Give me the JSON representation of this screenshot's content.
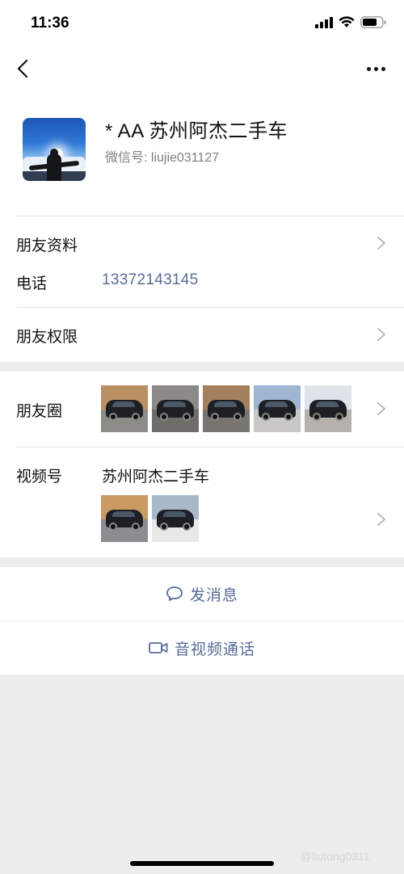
{
  "status_bar": {
    "time": "11:36"
  },
  "profile": {
    "name": "* AA 苏州阿杰二手车",
    "wechat_id": "微信号: liujie031127"
  },
  "rows": {
    "friend_info": "朋友资料",
    "phone_label": "电话",
    "phone_value": "13372143145",
    "permissions": "朋友权限",
    "moments": "朋友圈",
    "channels": "视频号",
    "channels_author": "苏州阿杰二手车"
  },
  "actions": {
    "message": "发消息",
    "call": "音视频通话"
  },
  "icons": {
    "back": "chevron-left-icon",
    "more": "more-dots-icon",
    "chevron": "chevron-right-icon",
    "message": "chat-bubble-icon",
    "call": "video-camera-icon"
  },
  "colors": {
    "link": "#576b95",
    "background": "#ededed",
    "divider": "#e5e5e5"
  },
  "watermark": "@liutong0311",
  "moments_photos": [
    {
      "name": "moments-photo-1",
      "sky": "#b98f63",
      "floor": "#8d8c89"
    },
    {
      "name": "moments-photo-2",
      "sky": "#8b8a86",
      "floor": "#6f6d6a"
    },
    {
      "name": "moments-photo-3",
      "sky": "#a4805d",
      "floor": "#787570"
    },
    {
      "name": "moments-photo-4",
      "sky": "#9fb6d2",
      "floor": "#c9c8c6"
    },
    {
      "name": "moments-photo-5",
      "sky": "#dfe4ea",
      "floor": "#b5b2ad"
    }
  ],
  "channel_videos": [
    {
      "name": "channel-video-1",
      "sky": "#c99a62",
      "floor": "#8b8d90"
    },
    {
      "name": "channel-video-2",
      "sky": "#a9b8c8",
      "floor": "#e8e8e8"
    }
  ]
}
